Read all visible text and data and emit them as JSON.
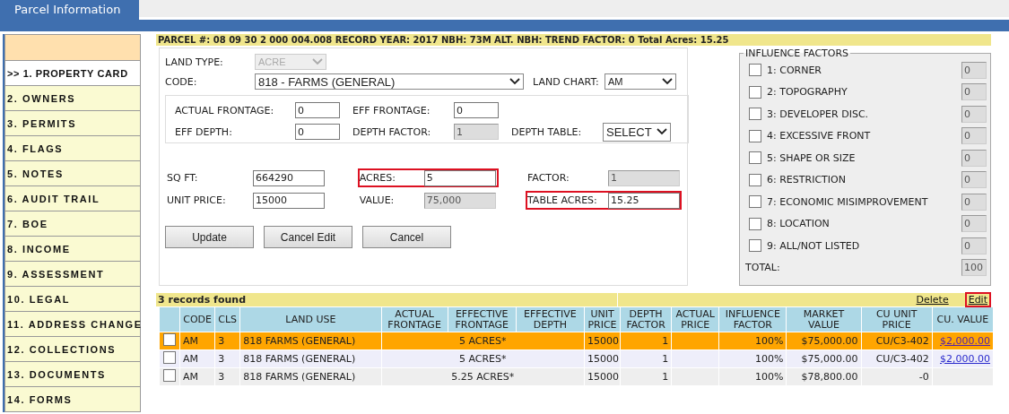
{
  "window": {
    "title": "Parcel Information"
  },
  "sidebar": {
    "items": [
      {
        "label": ">> 1. PROPERTY CARD",
        "selected": true
      },
      {
        "label": "2. OWNERS",
        "selected": false
      },
      {
        "label": "3. PERMITS",
        "selected": false
      },
      {
        "label": "4. FLAGS",
        "selected": false
      },
      {
        "label": "5. NOTES",
        "selected": false
      },
      {
        "label": "6. AUDIT TRAIL",
        "selected": false
      },
      {
        "label": "7. BOE",
        "selected": false
      },
      {
        "label": "8. INCOME",
        "selected": false
      },
      {
        "label": "9. ASSESSMENT",
        "selected": false
      },
      {
        "label": "10. LEGAL",
        "selected": false
      },
      {
        "label": "11. ADDRESS CHANGE",
        "selected": false
      },
      {
        "label": "12. COLLECTIONS",
        "selected": false
      },
      {
        "label": "13. DOCUMENTS",
        "selected": false
      },
      {
        "label": "14. FORMS",
        "selected": false
      }
    ]
  },
  "parcel_header": "PARCEL #: 08 09 30 2 000 004.008  RECORD YEAR: 2017  NBH: 73M  ALT. NBH:  TREND FACTOR: 0  Total Acres: 15.25",
  "form": {
    "top_rows": [
      [
        {
          "label": "LAND TYPE:",
          "value": "ACRE",
          "kind": "select",
          "disabled": true
        }
      ],
      [
        {
          "label": "CODE:",
          "value": "818 - FARMS (GENERAL)",
          "kind": "select",
          "disabled": false
        },
        {
          "label": "LAND CHART:",
          "value": "AM",
          "kind": "select",
          "disabled": false
        }
      ]
    ],
    "frontage_rows": [
      [
        {
          "label": "ACTUAL FRONTAGE:",
          "value": "0",
          "kind": "input",
          "readonly": false
        },
        {
          "label": "EFF FRONTAGE:",
          "value": "0",
          "kind": "input",
          "readonly": false
        }
      ],
      [
        {
          "label": "EFF DEPTH:",
          "value": "0",
          "kind": "input",
          "readonly": false
        },
        {
          "label": "DEPTH FACTOR:",
          "value": "1",
          "kind": "input",
          "readonly": true
        },
        {
          "label": "DEPTH TABLE:",
          "value": "SELECT",
          "kind": "select",
          "disabled": false
        }
      ]
    ],
    "value_rows": [
      [
        {
          "label": "SQ FT:",
          "value": "664290",
          "readonly": false,
          "highlighted": false
        },
        {
          "label": "ACRES:",
          "value": "5",
          "readonly": false,
          "highlighted": true
        },
        {
          "label": "FACTOR:",
          "value": "1",
          "readonly": true,
          "highlighted": false
        }
      ],
      [
        {
          "label": "UNIT PRICE:",
          "value": "15000",
          "readonly": false,
          "highlighted": false
        },
        {
          "label": "VALUE:",
          "value": "75,000",
          "readonly": true,
          "highlighted": false
        },
        {
          "label": "TABLE ACRES:",
          "value": "15.25",
          "readonly": false,
          "highlighted": true
        }
      ]
    ],
    "buttons": [
      "Update",
      "Cancel Edit",
      "Cancel"
    ]
  },
  "influence_factors": {
    "title": "INFLUENCE FACTORS",
    "items": [
      {
        "label": "1: CORNER",
        "checked": false,
        "value": "0"
      },
      {
        "label": "2: TOPOGRAPHY",
        "checked": false,
        "value": "0"
      },
      {
        "label": "3: DEVELOPER DISC.",
        "checked": false,
        "value": "0"
      },
      {
        "label": "4: EXCESSIVE FRONT",
        "checked": false,
        "value": "0"
      },
      {
        "label": "5: SHAPE OR SIZE",
        "checked": false,
        "value": "0"
      },
      {
        "label": "6: RESTRICTION",
        "checked": false,
        "value": "0"
      },
      {
        "label": "7: ECONOMIC MISIMPROVEMENT",
        "checked": false,
        "value": "0"
      },
      {
        "label": "8: LOCATION",
        "checked": false,
        "value": "0"
      },
      {
        "label": "9: ALL/NOT LISTED",
        "checked": false,
        "value": "0"
      }
    ],
    "total_label": "TOTAL:",
    "total_value": "100"
  },
  "records": {
    "count": "3 records found",
    "actions": [
      {
        "label": "Delete",
        "highlighted": false
      },
      {
        "label": "Edit",
        "highlighted": true
      }
    ],
    "columns": [
      "CODE",
      "CLS",
      "LAND USE",
      "ACTUAL FRONTAGE",
      "EFFECTIVE FRONTAGE",
      "EFFECTIVE DEPTH",
      "UNIT PRICE",
      "DEPTH FACTOR",
      "ACTUAL PRICE",
      "INFLUENCE FACTOR",
      "MARKET VALUE",
      "CU UNIT PRICE",
      "CU. VALUE"
    ],
    "rows": [
      {
        "selected": true,
        "checked": false,
        "code": "AM",
        "cls": "3",
        "land_use": "818 FARMS (GENERAL)",
        "frontage": "5 ACRES*",
        "unit_price": "15000",
        "depth_factor": "1",
        "influence_factor": "100%",
        "market_value": "$75,000.00",
        "cu_unit_price": "CU/C3-402",
        "cu_value": "$2,000.00"
      },
      {
        "selected": false,
        "checked": false,
        "code": "AM",
        "cls": "3",
        "land_use": "818 FARMS (GENERAL)",
        "frontage": "5 ACRES*",
        "unit_price": "15000",
        "depth_factor": "1",
        "influence_factor": "100%",
        "market_value": "$75,000.00",
        "cu_unit_price": "CU/C3-402",
        "cu_value": "$2,000.00"
      },
      {
        "selected": false,
        "checked": false,
        "code": "AM",
        "cls": "3",
        "land_use": "818 FARMS (GENERAL)",
        "frontage": "5.25 ACRES*",
        "unit_price": "15000",
        "depth_factor": "1",
        "influence_factor": "100%",
        "market_value": "$78,800.00",
        "cu_unit_price": "-0"
      }
    ]
  }
}
